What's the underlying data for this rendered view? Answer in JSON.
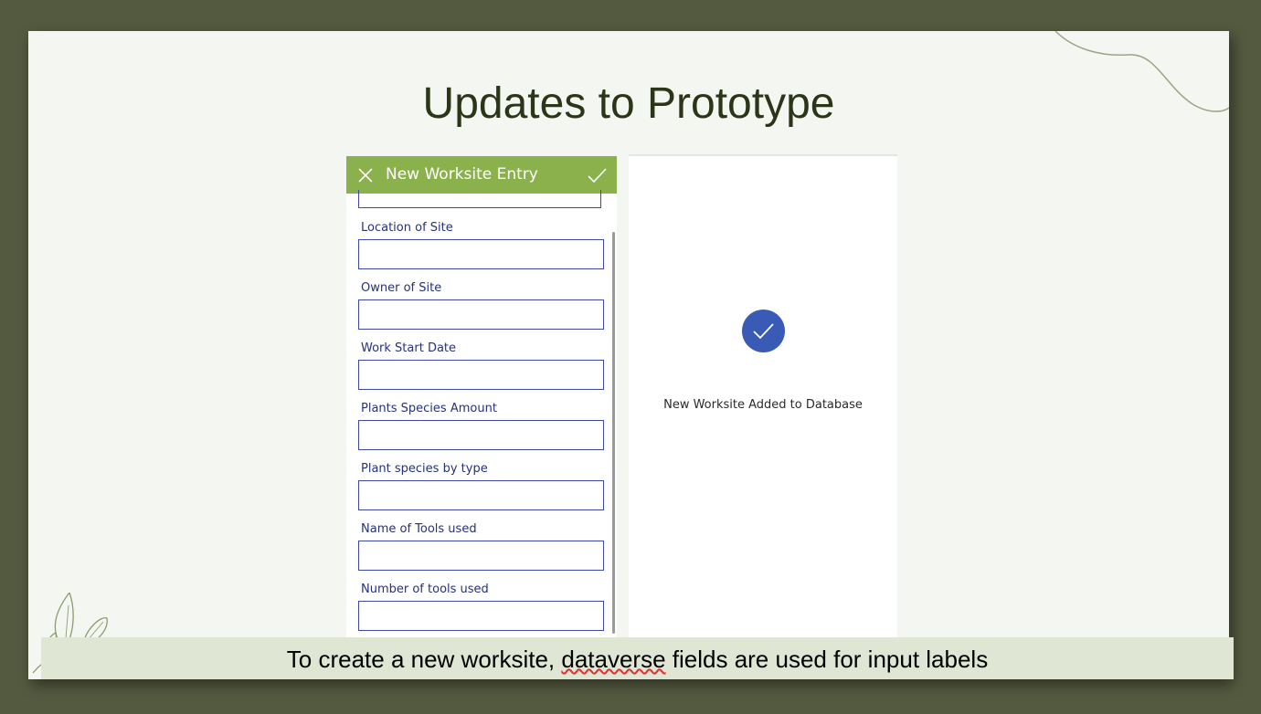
{
  "slide": {
    "title": "Updates to Prototype"
  },
  "form": {
    "header_title": "New Worksite Entry",
    "fields": [
      {
        "label": "Location of Site",
        "value": ""
      },
      {
        "label": "Owner of Site",
        "value": ""
      },
      {
        "label": "Work Start Date",
        "value": ""
      },
      {
        "label": "Plants Species Amount",
        "value": ""
      },
      {
        "label": "Plant species by type",
        "value": ""
      },
      {
        "label": "Name of Tools used",
        "value": ""
      },
      {
        "label": "Number of tools used",
        "value": ""
      }
    ]
  },
  "success": {
    "message": "New Worksite Added to Database"
  },
  "caption": {
    "before": "To create a new worksite, ",
    "flagged_word": "dataverse",
    "after": " fields are used for input labels"
  },
  "colors": {
    "background": "#545a3f",
    "slide": "#f4f7f1",
    "header_green": "#8ab14b",
    "field_border": "#3f49a4",
    "label_text": "#26327a",
    "check_blue": "#3a5bb5",
    "caption_bg": "#dfe6d3"
  },
  "icons": {
    "close": "close-icon",
    "submit": "checkmark-icon",
    "success": "check-circle-icon"
  }
}
